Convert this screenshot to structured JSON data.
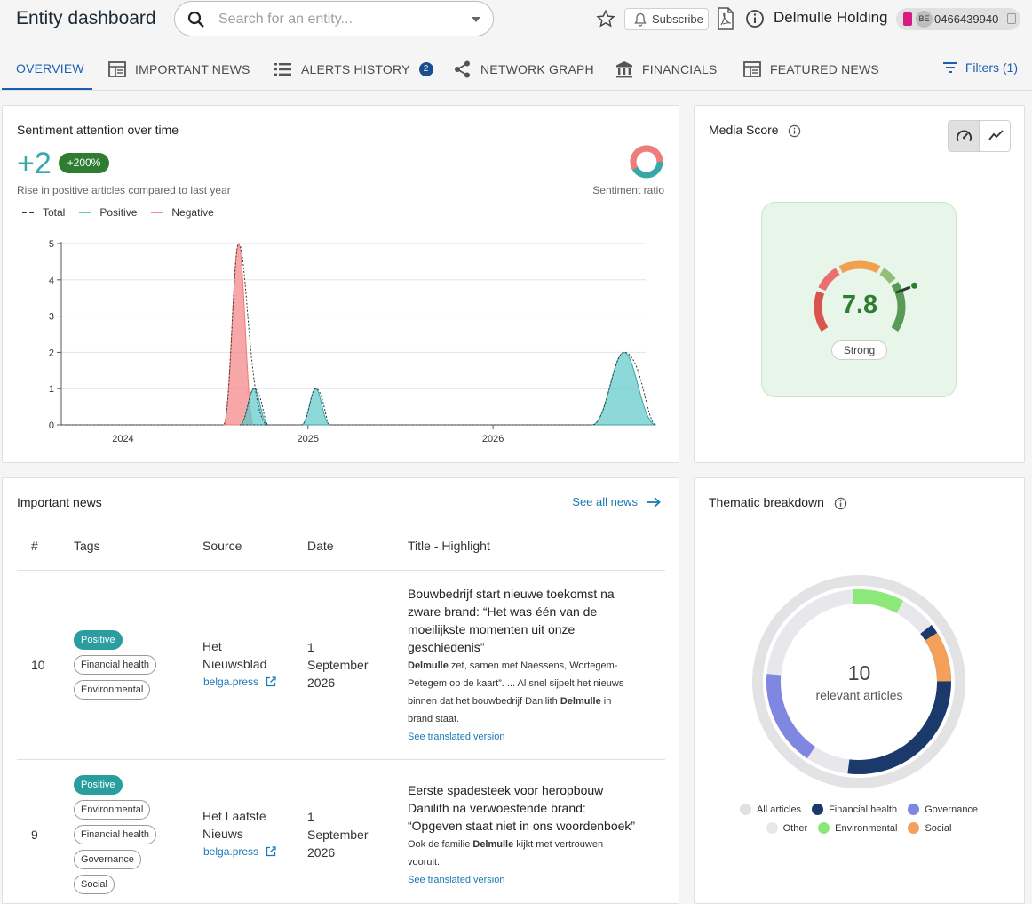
{
  "header": {
    "title": "Entity dashboard",
    "search_placeholder": "Search for an entity...",
    "subscribe_label": "Subscribe",
    "entity_name": "Delmulle Holding",
    "country_code": "BE",
    "vat_number": "0466439940"
  },
  "tabs": [
    {
      "label": "OVERVIEW",
      "icon": "none",
      "active": true
    },
    {
      "label": "IMPORTANT NEWS",
      "icon": "newspaper-icon"
    },
    {
      "label": "ALERTS HISTORY",
      "icon": "list-icon",
      "badge": "2"
    },
    {
      "label": "NETWORK GRAPH",
      "icon": "share-icon"
    },
    {
      "label": "FINANCIALS",
      "icon": "bank-icon"
    },
    {
      "label": "FEATURED NEWS",
      "icon": "newspaper-icon"
    }
  ],
  "filters_label": "Filters (1)",
  "sentiment": {
    "title": "Sentiment attention over time",
    "big_number": "+2",
    "percent_badge": "+200%",
    "subtext": "Rise in positive articles compared to last year",
    "ratio_label": "Sentiment ratio",
    "legend": {
      "total": "Total",
      "positive": "Positive",
      "negative": "Negative"
    },
    "colors": {
      "positive": "#5cc8c8",
      "negative": "#f48a8a",
      "total": "#333333"
    }
  },
  "chart_data": {
    "type": "area",
    "x_ticks": [
      "2024",
      "2025",
      "2026"
    ],
    "y_ticks": [
      0,
      1,
      2,
      3,
      4,
      5
    ],
    "ylim": [
      0,
      5
    ],
    "series": [
      {
        "name": "Negative",
        "peaks": [
          {
            "x": "2024-08",
            "value": 5
          }
        ]
      },
      {
        "name": "Positive",
        "peaks": [
          {
            "x": "2024-09",
            "value": 1
          },
          {
            "x": "2025-01",
            "value": 1
          },
          {
            "x": "2026-09",
            "value": 2
          }
        ]
      },
      {
        "name": "Total",
        "peaks": [
          {
            "x": "2024-08",
            "value": 5
          },
          {
            "x": "2024-09",
            "value": 1
          },
          {
            "x": "2025-01",
            "value": 1
          },
          {
            "x": "2026-09",
            "value": 2
          }
        ]
      }
    ],
    "grid": true,
    "legend_position": "top-left"
  },
  "media_score": {
    "title": "Media Score",
    "value": "7.8",
    "level": 0.78,
    "label": "Strong"
  },
  "important_news": {
    "title": "Important news",
    "see_all": "See all news",
    "columns": [
      "#",
      "Tags",
      "Source",
      "Date",
      "Title - Highlight"
    ],
    "rows": [
      {
        "num": "10",
        "tags": [
          "Positive",
          "Financial health",
          "Environmental"
        ],
        "source_lines": [
          "Het",
          "Nieuwsblad"
        ],
        "source_link": "belga.press",
        "date_lines": [
          "1",
          "September",
          "2026"
        ],
        "title_lines": [
          "Bouwbedrijf start nieuwe toekomst na",
          "zware brand: “Het was één van de",
          "moeilijkste momenten uit onze",
          "geschiedenis”"
        ],
        "body_lines": [
          "Delmulle zet, samen met Naessens, Wortegem-",
          "Petegem op de kaart”. ... Al snel sijpelt het nieuws",
          "binnen dat het bouwbedrijf Danilith Delmulle in",
          "brand staat."
        ],
        "translate": "See translated version"
      },
      {
        "num": "9",
        "tags": [
          "Positive",
          "Environmental",
          "Financial health",
          "Governance",
          "Social"
        ],
        "source_lines": [
          "Het Laatste",
          "Nieuws"
        ],
        "source_link": "belga.press",
        "date_lines": [
          "1",
          "September",
          "2026"
        ],
        "title_lines": [
          "Eerste spadesteek voor heropbouw",
          "Danilith na verwoestende brand:",
          "“Opgeven staat niet in ons woordenboek”"
        ],
        "body_lines": [
          "Ook de familie Delmulle kijkt met vertrouwen",
          "vooruit."
        ],
        "translate": "See translated version"
      }
    ]
  },
  "thematic": {
    "title": "Thematic breakdown",
    "count": "10",
    "count_label": "relevant articles",
    "legend_row1": [
      {
        "label": "All articles",
        "color": "#e0e0e0"
      },
      {
        "label": "Financial health",
        "color": "#1b3a6b"
      },
      {
        "label": "Governance",
        "color": "#8087e0"
      }
    ],
    "legend_row2": [
      {
        "label": "Other",
        "color": "#e8e8ec"
      },
      {
        "label": "Environmental",
        "color": "#8de87a"
      },
      {
        "label": "Social",
        "color": "#f5a05a"
      }
    ]
  }
}
